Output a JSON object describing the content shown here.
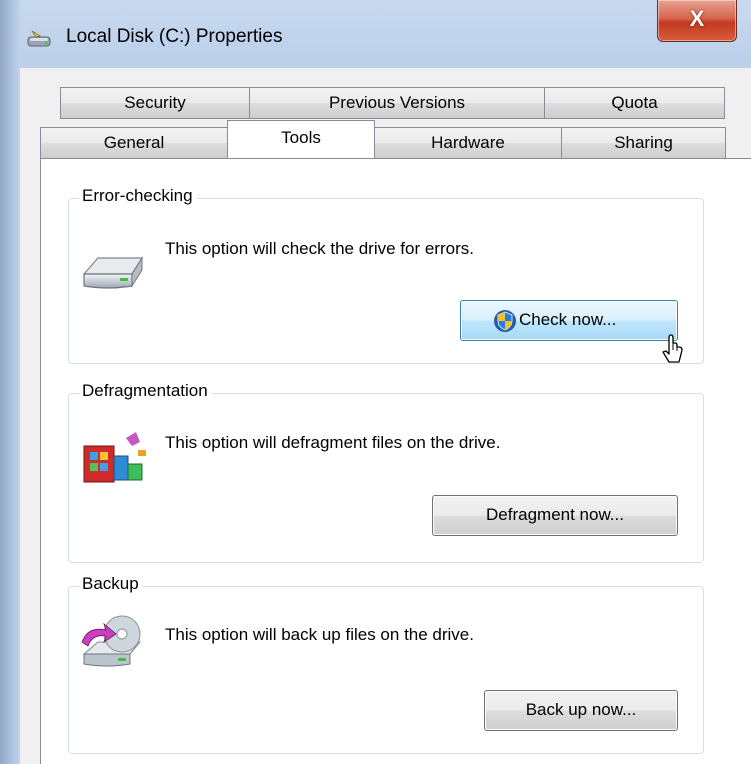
{
  "window": {
    "title": "Local Disk (C:) Properties",
    "close_glyph": "X"
  },
  "tabs": {
    "back_row": [
      "Security",
      "Previous Versions",
      "Quota"
    ],
    "front_row": [
      "General",
      "Tools",
      "Hardware",
      "Sharing"
    ],
    "active": "Tools"
  },
  "sections": {
    "error_checking": {
      "title": "Error-checking",
      "description": "This option will check the drive for errors.",
      "button": "Check now...",
      "icon": "drive-icon"
    },
    "defragmentation": {
      "title": "Defragmentation",
      "description": "This option will defragment files on the drive.",
      "button": "Defragment now...",
      "icon": "defrag-icon"
    },
    "backup": {
      "title": "Backup",
      "description": "This option will back up files on the drive.",
      "button": "Back up now...",
      "icon": "backup-icon"
    }
  },
  "colors": {
    "accent": "#3c7fb1",
    "close_red": "#c23a1f"
  }
}
